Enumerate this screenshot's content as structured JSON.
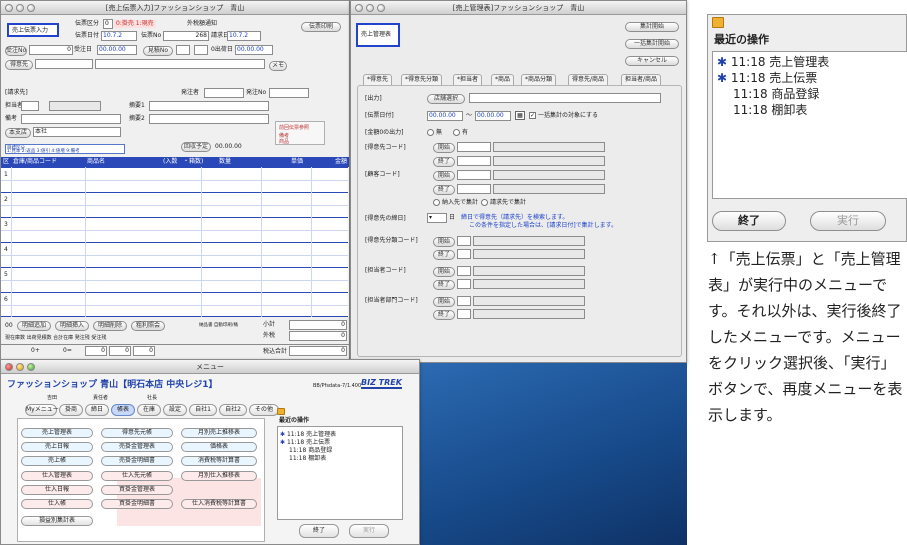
{
  "slip_window": {
    "title": "[売上伝票入力]ファッションショップ　青山",
    "mode_button": "売上伝票入力",
    "slip_type_label": "伝票区分",
    "slip_type_value": "0",
    "slip_type_options": "0:掛売  1:現売",
    "tax_notice_label": "外税額通知",
    "print_button": "伝票印刷",
    "slip_date_label": "伝票日付",
    "slip_date_value": "10.7.2",
    "slip_no_label": "伝票No",
    "slip_no_value": "268",
    "billing_date_label": "請求日",
    "billing_date_value": "10.7.2",
    "order_no_label": "受注No",
    "order_no_value": "0",
    "order_date_label": "受注日",
    "order_date_value": "00.00.00",
    "estimate_label": "見積No",
    "shipping_label": "0出荷日",
    "shipping_value": "00.00.00",
    "customer_button": "得意先",
    "memo_label": "メモ",
    "billing_to_label": "[請求先]",
    "orderer_label": "発注者",
    "orderer_no_label": "発注No",
    "staff_label": "担当者",
    "note1_label": "摘要1",
    "note_label": "備考",
    "note2_label": "摘要2",
    "branch_button": "本支店",
    "branch_value": "本社",
    "stamp_text": "前回伝票参照",
    "remark_a": "備考",
    "remark_b": "商品",
    "split_label": "目標区分",
    "split_options": "1:見本  2:返品  3:値引  4:値増  9:備考",
    "amount_button": "回収予定",
    "amount_value": "00.00.00",
    "grid_headers": [
      "区",
      "倉庫/商品コード",
      "商品名",
      "(入数",
      "・箱数)",
      "数量",
      "単価",
      "金額"
    ],
    "rows": [
      "1",
      "2",
      "3",
      "4",
      "5",
      "6"
    ],
    "footer_buttons": [
      "明細追加",
      "明細挿入",
      "明細削除",
      "粗利照会"
    ],
    "footer_code": "00",
    "footer_info": "納品書 自動印刷/桶",
    "subtotal_label": "小計",
    "subtotal_value": "0",
    "outer_tax_label": "外税",
    "outer_tax_value": "0",
    "total_label": "税込合計",
    "total_value": "0",
    "stock_labels": "現在庫数  出荷見積数  合計在庫  発注残  受注残",
    "stock_values": [
      "0+",
      "0=",
      "0",
      "0",
      "0"
    ]
  },
  "report_window": {
    "title": "[売上管理表]ファッションショップ　青山",
    "mode_button": "売上管理表",
    "side_buttons": [
      "集計開始",
      "一括集計開始",
      "キャンセル"
    ],
    "tabs": [
      "*得意先",
      "*得意先分類",
      "*担当者",
      "*商品",
      "*商品分類",
      "得意先/商品",
      "担当者/商品"
    ],
    "form_button": "[出力]",
    "form_select": "店舗選択",
    "date_label": "[伝票日付]",
    "date_from": "00.00.00",
    "date_sep": "〜",
    "date_to": "00.00.00",
    "date_check": "一括集計の対象にする",
    "zero_label": "[金額0の出力]",
    "zero_options": [
      "無",
      "有"
    ],
    "customer_code_label": "[得意先コード]",
    "client_code_label": "[顧客コード]",
    "start_label": "開始",
    "end_label": "終了",
    "delivery_option": "納入先で集計",
    "billing_option": "請求先で集計",
    "closing_label": "[得意先の締日]",
    "closing_unit": "日",
    "closing_note1": "締日で得意先（請求先）を検索します。",
    "closing_note2": "この条件を指定した場合は、[請求日付]で集計します。",
    "class_code_label": "[得意先分類コード]",
    "staff_code_label": "[担当者コード]",
    "dept_code_label": "[担当者部門コード]"
  },
  "menu_window": {
    "title": "メニュー",
    "shop": "ファッションショップ 青山【明石本店 中央レジ1】",
    "sub_labels": [
      "吉田",
      "責任者",
      "社長"
    ],
    "version": "BB/Pfsdata-7/1.400",
    "logo": "BIZ TREK",
    "tabs": [
      "Myメニュー",
      "掛商",
      "締日",
      "帳表",
      "在庫",
      "設定",
      "自社1",
      "自社2",
      "その他"
    ],
    "selected_tab": "帳表",
    "buttons_col1": [
      "売上管理表",
      "売上日報",
      "売上帳",
      "仕入管理表",
      "仕入日報",
      "仕入帳",
      "損益別集計表"
    ],
    "buttons_col2": [
      "得意先元帳",
      "売掛金管理表",
      "売掛金明細書",
      "仕入先元帳",
      "買掛金管理表",
      "買掛金明細書"
    ],
    "buttons_col3": [
      "月別売上推移表",
      "価格表",
      "消費税等計算書",
      "月別仕入推移表",
      "仕入消費税等計算書"
    ],
    "recent_title": "最近の操作",
    "recent": [
      "11:18 売上管理表",
      "11:18 売上伝票",
      "11:18 商品登録",
      "11:18 棚卸表"
    ],
    "end_button": "終了",
    "run_button": "実行"
  },
  "zoom_panel": {
    "title": "最近の操作",
    "items": [
      "11:18 売上管理表",
      "11:18 売上伝票",
      "11:18 商品登録",
      "11:18 棚卸表"
    ],
    "end_button": "終了",
    "run_button": "実行"
  },
  "caption": "↑「売上伝票」と「売上管理表」が実行中のメニューです。それ以外は、実行後終了したメニューです。メニューをクリック選択後、「実行」ボタンで、再度メニューを表示します。"
}
